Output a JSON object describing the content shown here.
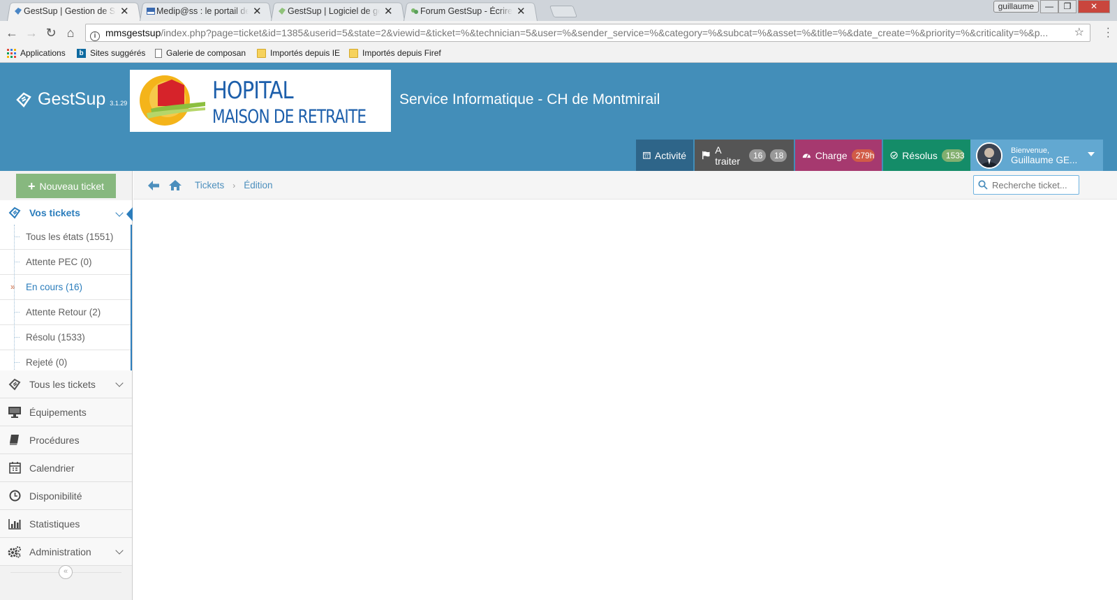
{
  "browser": {
    "tabs": [
      {
        "label": "GestSup | Gestion de Sup",
        "active": true
      },
      {
        "label": "Medip@ss : le portail des",
        "active": false
      },
      {
        "label": "GestSup | Logiciel de ges",
        "active": false
      },
      {
        "label": "Forum GestSup - Écrire u",
        "active": false
      }
    ],
    "os_user": "guillaume",
    "url_host": "mmsgestsup",
    "url_path": "/index.php?page=ticket&id=1385&userid=5&state=2&viewid=&ticket=%&technician=5&user=%&sender_service=%&category=%&subcat=%&asset=%&title=%&date_create=%&priority=%&criticality=%&p...",
    "bookmarks": [
      "Applications",
      "Sites suggérés",
      "Galerie de composan",
      "Importés depuis IE",
      "Importés depuis Firef"
    ]
  },
  "header": {
    "brand": "GestSup",
    "version": "3.1.29",
    "logo_line1": "HOPITAL",
    "logo_line2": "MAISON DE RETRAITE",
    "service": "Service Informatique - CH de Montmirail",
    "tabs": {
      "activite": "Activité",
      "a_traiter": "A traiter",
      "a_traiter_badge1": "16",
      "a_traiter_badge2": "18",
      "charge": "Charge",
      "charge_badge": "279h",
      "resolus": "Résolus",
      "resolus_badge": "1533"
    },
    "user_greeting": "Bienvenue,",
    "user_name": "Guillaume GE..."
  },
  "colors": {
    "header": "#438eb9",
    "activite": "#2e6589",
    "a_traiter": "#555555",
    "charge": "#a6396f",
    "resolus": "#148c68",
    "userbox": "#62a8d1"
  },
  "sidebar": {
    "new_ticket": "Nouveau ticket",
    "vos_tickets": "Vos tickets",
    "sub": [
      "Tous les états (1551)",
      "Attente PEC (0)",
      "En cours (16)",
      "Attente Retour (2)",
      "Résolu (1533)",
      "Rejeté (0)"
    ],
    "items": [
      "Tous les tickets",
      "Équipements",
      "Procédures",
      "Calendrier",
      "Disponibilité",
      "Statistiques",
      "Administration"
    ]
  },
  "breadcrumb": {
    "tickets": "Tickets",
    "edition": "Édition"
  },
  "search": {
    "placeholder": "Recherche ticket..."
  }
}
